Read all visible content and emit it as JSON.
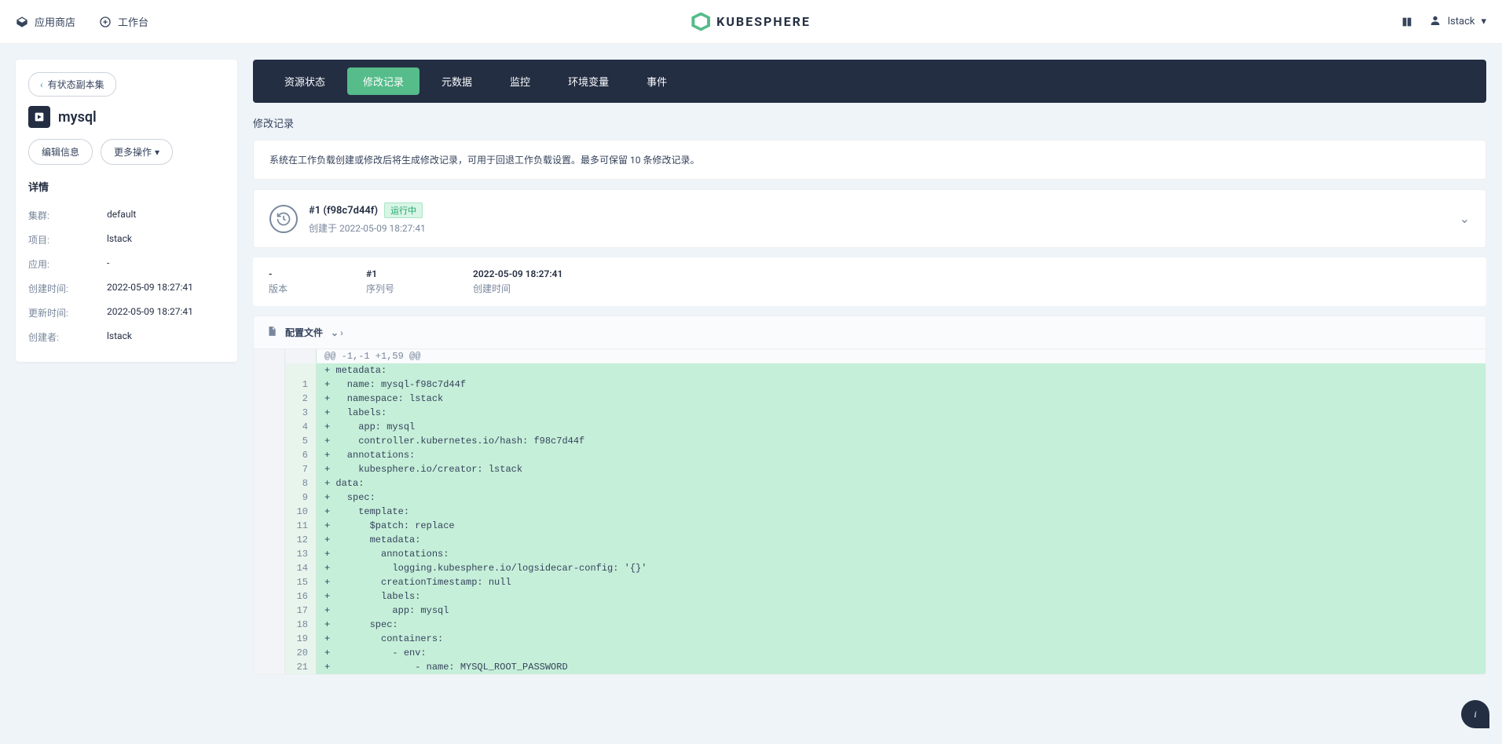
{
  "topbar": {
    "appstore": "应用商店",
    "workspace": "工作台",
    "brand": "KUBESPHERE",
    "user": "lstack"
  },
  "sidebar": {
    "back_label": "有状态副本集",
    "resource_name": "mysql",
    "edit_btn": "编辑信息",
    "more_btn": "更多操作",
    "detail_hdr": "详情",
    "details": [
      {
        "k": "集群:",
        "v": "default"
      },
      {
        "k": "项目:",
        "v": "lstack"
      },
      {
        "k": "应用:",
        "v": "-"
      },
      {
        "k": "创建时间:",
        "v": "2022-05-09 18:27:41"
      },
      {
        "k": "更新时间:",
        "v": "2022-05-09 18:27:41"
      },
      {
        "k": "创建者:",
        "v": "lstack"
      }
    ]
  },
  "tabs": [
    "资源状态",
    "修改记录",
    "元数据",
    "监控",
    "环境变量",
    "事件"
  ],
  "active_tab": 1,
  "content": {
    "title": "修改记录",
    "banner": "系统在工作负载创建或修改后将生成修改记录，可用于回退工作负载设置。最多可保留 10 条修改记录。",
    "revision": {
      "title": "#1 (f98c7d44f)",
      "status": "运行中",
      "created": "创建于 2022-05-09 18:27:41"
    },
    "meta": [
      {
        "v": "-",
        "l": "版本"
      },
      {
        "v": "#1",
        "l": "序列号"
      },
      {
        "v": "2022-05-09 18:27:41",
        "l": "创建时间"
      }
    ],
    "diff": {
      "header": "配置文件",
      "hunk": "@@ -1,-1 +1,59 @@",
      "lines": [
        {
          "n": "",
          "t": "+ metadata:"
        },
        {
          "n": "1",
          "t": "+   name: mysql-f98c7d44f"
        },
        {
          "n": "2",
          "t": "+   namespace: lstack"
        },
        {
          "n": "3",
          "t": "+   labels:"
        },
        {
          "n": "4",
          "t": "+     app: mysql"
        },
        {
          "n": "5",
          "t": "+     controller.kubernetes.io/hash: f98c7d44f"
        },
        {
          "n": "6",
          "t": "+   annotations:"
        },
        {
          "n": "7",
          "t": "+     kubesphere.io/creator: lstack"
        },
        {
          "n": "8",
          "t": "+ data:"
        },
        {
          "n": "9",
          "t": "+   spec:"
        },
        {
          "n": "10",
          "t": "+     template:"
        },
        {
          "n": "11",
          "t": "+       $patch: replace"
        },
        {
          "n": "12",
          "t": "+       metadata:"
        },
        {
          "n": "13",
          "t": "+         annotations:"
        },
        {
          "n": "14",
          "t": "+           logging.kubesphere.io/logsidecar-config: '{}'"
        },
        {
          "n": "15",
          "t": "+         creationTimestamp: null"
        },
        {
          "n": "16",
          "t": "+         labels:"
        },
        {
          "n": "17",
          "t": "+           app: mysql"
        },
        {
          "n": "18",
          "t": "+       spec:"
        },
        {
          "n": "19",
          "t": "+         containers:"
        },
        {
          "n": "20",
          "t": "+           - env:"
        },
        {
          "n": "21",
          "t": "+               - name: MYSQL_ROOT_PASSWORD"
        }
      ]
    }
  }
}
